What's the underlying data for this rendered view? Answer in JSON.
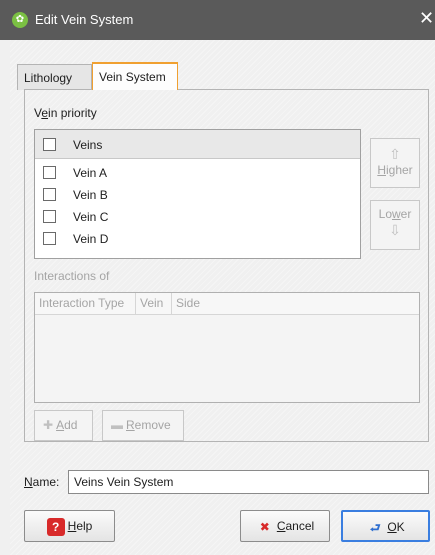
{
  "window": {
    "title": "Edit Vein System",
    "close_glyph": "✕"
  },
  "tabs": [
    {
      "label": "Lithology"
    },
    {
      "label": "Vein System"
    }
  ],
  "vein_priority": {
    "label_pre": "V",
    "label_underlined": "e",
    "label_post": "in priority",
    "column_header": "Veins",
    "veins": [
      {
        "label": "Vein A"
      },
      {
        "label": "Vein B"
      },
      {
        "label": "Vein C"
      },
      {
        "label": "Vein D"
      }
    ],
    "higher": {
      "label_underlined": "H",
      "label_rest": "igher",
      "icon": "up-arrow-icon"
    },
    "lower": {
      "label_pre": "Lo",
      "label_underlined": "w",
      "label_post": "er",
      "icon": "down-arrow-icon"
    }
  },
  "interactions": {
    "label": "Interactions of",
    "columns": [
      "Interaction Type",
      "Vein",
      "Side"
    ],
    "add": {
      "label_underlined": "A",
      "label_rest": "dd",
      "icon": "plus-icon"
    },
    "remove": {
      "label_underlined": "R",
      "label_rest": "emove",
      "icon": "minus-icon"
    }
  },
  "name": {
    "label_underlined": "N",
    "label_rest": "ame:",
    "value": "Veins Vein System"
  },
  "buttons": {
    "help": {
      "label_underlined": "H",
      "label_rest": "elp",
      "icon": "help-icon"
    },
    "cancel": {
      "label_underlined": "C",
      "label_rest": "ancel",
      "icon": "cancel-icon"
    },
    "ok": {
      "label_underlined": "O",
      "label_rest": "K",
      "icon": "ok-icon"
    }
  },
  "colors": {
    "titlebar": "#5a5a5a",
    "active_tab_accent": "#f0a030",
    "ok_focus": "#3a7ee0",
    "app_icon": "#7bc043"
  }
}
